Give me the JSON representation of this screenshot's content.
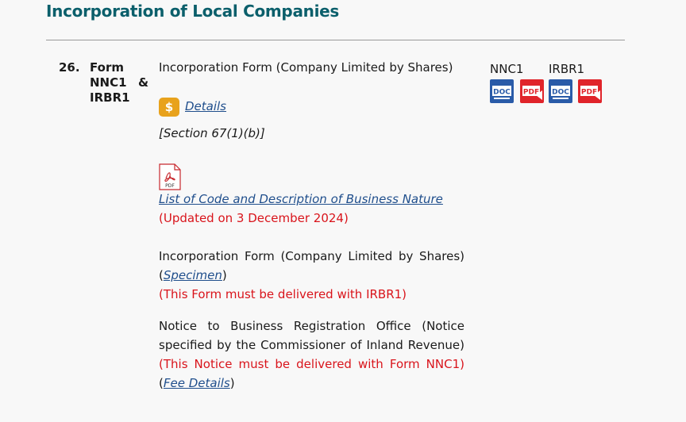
{
  "page_title": "Incorporation of Local Companies",
  "entry": {
    "number": "26.",
    "form_label_line1": "Form",
    "form_label_line2": "NNC1",
    "form_label_amp": "&",
    "form_label_line3": "IRBR1",
    "form_name": "Incorporation Form (Company Limited by Shares)",
    "fee_link": "Details",
    "section_ref": "[Section 67(1)(b)]",
    "business_nature_link": "List of Code and Description of Business Nature",
    "business_nature_updated": "(Updated on 3 December 2024)",
    "form_name_2_prefix": "Incorporation Form (Company Limited by Shares) (",
    "specimen_link": "Specimen",
    "close_paren": ")",
    "form_note": "(This Form must be delivered with IRBR1)",
    "notice_name": "Notice to Business Registration Office (Notice specified by the Commissioner of Inland Revenue)",
    "notice_note": "(This Notice must be delivered with Form NNC1)",
    "notice_open_paren": " (",
    "fee_details_link": "Fee Details",
    "notice_close_paren": ")"
  },
  "downloads": {
    "nnc1_label": "NNC1",
    "irbr1_label": "IRBR1",
    "doc_icon_text": "DOC",
    "pdf_icon_text": "PDF",
    "pdf_small_text": "PDF"
  },
  "colors": {
    "title": "#0b5f6b",
    "link": "#1f4e8c",
    "note_red": "#d9141b",
    "doc_blue": "#2a5ba8",
    "pdf_red": "#e0242a",
    "fee_icon": "#e8a21c"
  }
}
